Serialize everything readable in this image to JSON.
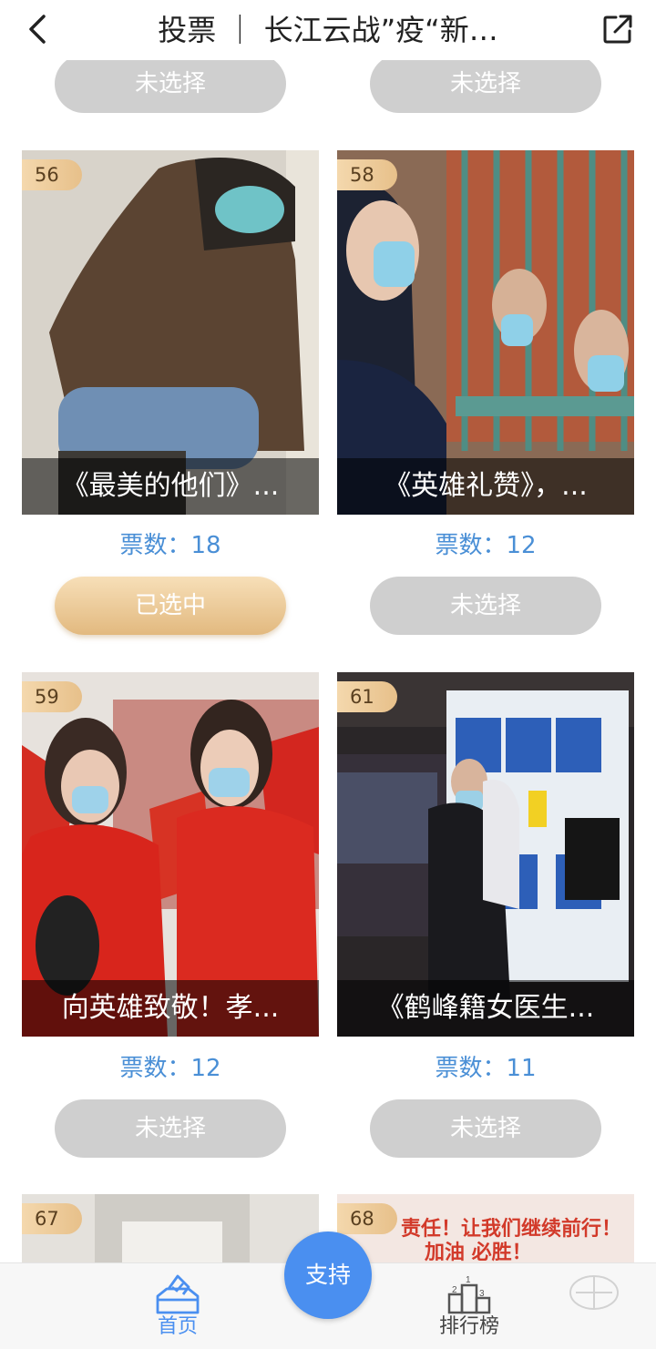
{
  "header": {
    "title": "投票 ｜ 长江云战”疫“新…",
    "back_icon": "chevron-left-icon",
    "share_icon": "share-external-icon"
  },
  "top_row": {
    "left_button": "未选择",
    "right_button": "未选择"
  },
  "cards": [
    {
      "badge": "56",
      "caption": "《最美的他们》...",
      "votes_label": "票数：",
      "votes": "18",
      "button": "已选中",
      "selected": true
    },
    {
      "badge": "58",
      "caption": "《英雄礼赞》，...",
      "votes_label": "票数：",
      "votes": "12",
      "button": "未选择",
      "selected": false
    },
    {
      "badge": "59",
      "caption": "向英雄致敬！孝...",
      "votes_label": "票数：",
      "votes": "12",
      "button": "未选择",
      "selected": false
    },
    {
      "badge": "61",
      "caption": "《鹤峰籍女医生...",
      "votes_label": "票数：",
      "votes": "11",
      "button": "未选择",
      "selected": false
    },
    {
      "badge": "67"
    },
    {
      "badge": "68",
      "overlay_text_line1": "责任！让我们继续前行！",
      "overlay_text_line2": "加油 必胜！"
    }
  ],
  "bottom_nav": {
    "home_label": "首页",
    "home_icon": "ballot-box-icon",
    "rank_label": "排行榜",
    "rank_icon": "podium-icon",
    "support_label": "支持"
  },
  "colors": {
    "accent_blue": "#4a8ff0",
    "votes_blue": "#4a8fd6",
    "selected_gold": "#e2b97f",
    "unselected_grey": "#cfcfcf"
  }
}
